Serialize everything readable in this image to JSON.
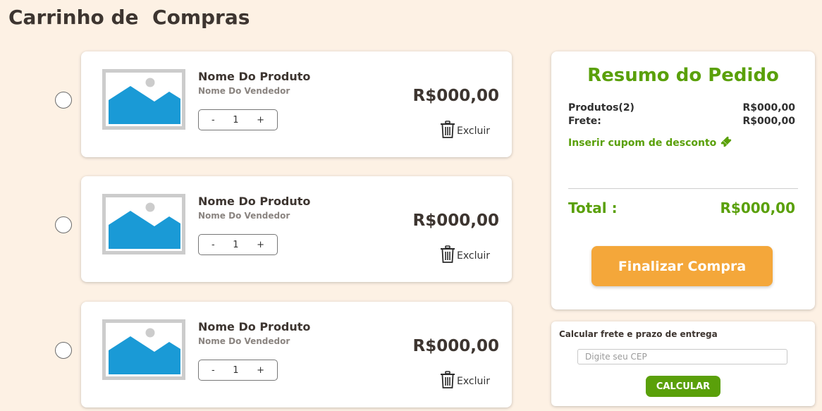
{
  "page": {
    "title": "Carrinho de  Compras"
  },
  "colors": {
    "background": "#fdf1e4",
    "accent_green": "#5aa00a",
    "checkout_orange": "#f4a73a",
    "image_placeholder_blue": "#1a9ad6",
    "image_placeholder_frame": "#cccccc"
  },
  "cart": {
    "items": [
      {
        "name": "Nome Do Produto",
        "seller": "Nome Do Vendedor",
        "quantity": "1",
        "price": "R$000,00",
        "remove_label": "Excluir",
        "selected": false
      },
      {
        "name": "Nome Do Produto",
        "seller": "Nome Do Vendedor",
        "quantity": "1",
        "price": "R$000,00",
        "remove_label": "Excluir",
        "selected": false
      },
      {
        "name": "Nome Do Produto",
        "seller": "Nome Do Vendedor",
        "quantity": "1",
        "price": "R$000,00",
        "remove_label": "Excluir",
        "selected": false
      }
    ],
    "qty_minus": "-",
    "qty_plus": "+",
    "image_icon": "image-placeholder-icon",
    "remove_icon": "trash-icon"
  },
  "summary": {
    "title": "Resumo do Pedido",
    "products_label": "Produtos(2)",
    "products_value": "R$000,00",
    "shipping_label": "Frete:",
    "shipping_value": "R$000,00",
    "coupon_label": "Inserir cupom de desconto",
    "coupon_icon": "ticket-icon",
    "total_label": "Total :",
    "total_value": "R$000,00",
    "checkout_label": "Finalizar Compra"
  },
  "shipping_calc": {
    "title": "Calcular frete e prazo de entrega",
    "cep_placeholder": "Digite seu CEP",
    "cep_value": "",
    "button_label": "CALCULAR"
  }
}
